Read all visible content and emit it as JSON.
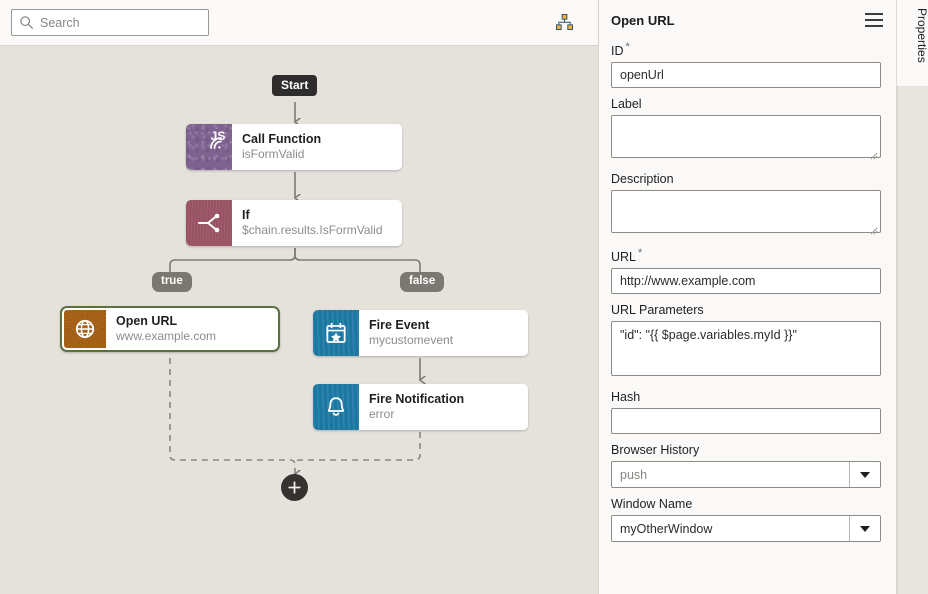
{
  "toolbar": {
    "search_placeholder": "Search",
    "search_value": "",
    "search_icon": "search-icon",
    "hierarchy_icon": "hierarchy-chart-icon"
  },
  "canvas": {
    "start_label": "Start",
    "branch_true_label": "true",
    "branch_false_label": "false",
    "add_label": "+",
    "nodes": [
      {
        "id": "call-function",
        "title": "Call Function",
        "subtitle": "isFormValid",
        "icon": "js-broadcast-icon",
        "icon_color": "#7e628f",
        "selected": false
      },
      {
        "id": "if",
        "title": "If",
        "subtitle": "$chain.results.IsFormValid",
        "icon": "branch-fork-icon",
        "icon_color": "#9c5566",
        "selected": false
      },
      {
        "id": "open-url",
        "title": "Open URL",
        "subtitle": "www.example.com",
        "icon": "globe-icon",
        "icon_color": "#a05a10",
        "selected": true
      },
      {
        "id": "fire-event",
        "title": "Fire Event",
        "subtitle": "mycustomevent",
        "icon": "calendar-star-icon",
        "icon_color": "#1c7ba6",
        "selected": false
      },
      {
        "id": "fire-notification",
        "title": "Fire Notification",
        "subtitle": "error",
        "icon": "bell-icon",
        "icon_color": "#1c7ba6",
        "selected": false
      }
    ]
  },
  "panel": {
    "title": "Open URL",
    "menu_icon": "hamburger-menu-icon",
    "tab_label": "Properties",
    "required_marker": "*",
    "fields": {
      "id": {
        "label": "ID",
        "value": "openUrl",
        "placeholder": "",
        "required": true
      },
      "label": {
        "label": "Label",
        "value": "",
        "placeholder": "",
        "required": false
      },
      "description": {
        "label": "Description",
        "value": "",
        "placeholder": "",
        "required": false
      },
      "url": {
        "label": "URL",
        "value": "http://www.example.com",
        "placeholder": "",
        "required": true
      },
      "url_parameters": {
        "label": "URL Parameters",
        "value": "\"id\": \"{{ $page.variables.myId }}\"",
        "placeholder": "",
        "required": false
      },
      "hash": {
        "label": "Hash",
        "value": "",
        "placeholder": "",
        "required": false
      },
      "browser_history": {
        "label": "Browser History",
        "value": "",
        "placeholder": "push",
        "required": false
      },
      "window_name": {
        "label": "Window Name",
        "value": "myOtherWindow",
        "placeholder": "",
        "required": false
      }
    }
  },
  "colors": {
    "canvas_bg": "#e5e2dc",
    "selection": "#5c7040",
    "connector": "#7e7a74",
    "pill": "#7b7771",
    "start": "#2e2d2b"
  }
}
